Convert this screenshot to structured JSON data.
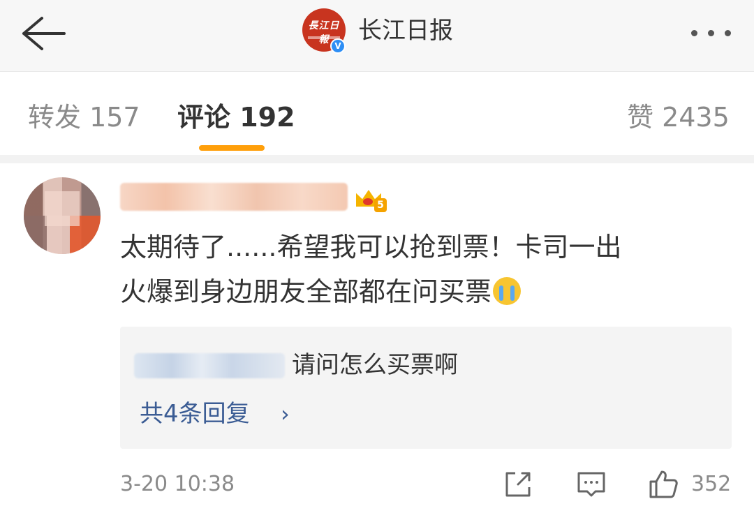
{
  "header": {
    "account_name": "长江日报",
    "logo_text": "長江日報",
    "verified_mark": "V",
    "icons": {
      "back": "back-arrow-icon",
      "more": "more-dots-icon"
    }
  },
  "tabs": {
    "repost": "转发 157",
    "comments": "评论 192",
    "likes": "赞 2435",
    "active": "comments",
    "accent_color": "#ff9f0a"
  },
  "comment": {
    "badge_level": "5",
    "text_line1": "太期待了......希望我可以抢到票！卡司一出",
    "text_line2": "火爆到身边朋友全部都在问买票",
    "emoji": "crying-emoji",
    "reply_preview_text": "请问怎么买票啊",
    "reply_more": "共4条回复",
    "reply_more_chevron": "›",
    "timestamp": "3-20 10:38",
    "like_count": "352",
    "link_color": "#3b5c94"
  }
}
